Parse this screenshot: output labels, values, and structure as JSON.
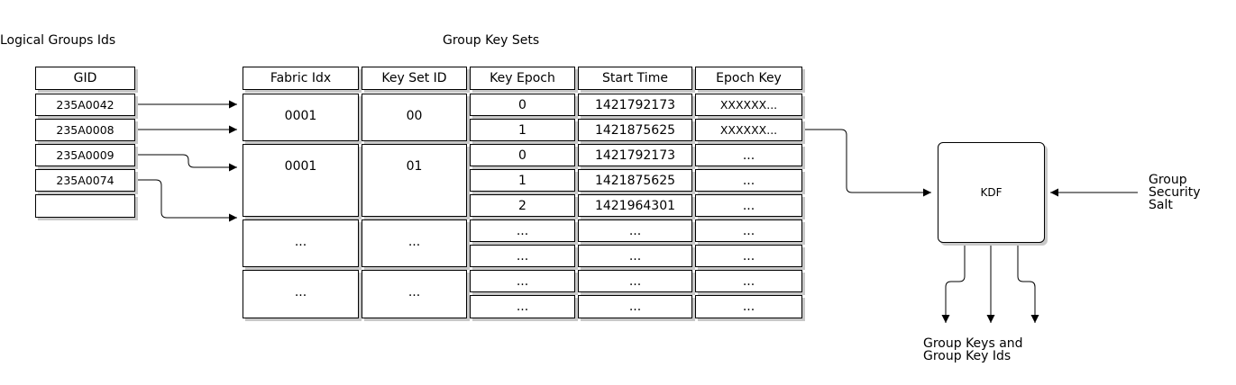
{
  "titles": {
    "logical_groups": "Logical Groups Ids",
    "key_sets": "Group Key Sets",
    "salt": [
      "Group",
      "Security",
      "Salt"
    ],
    "output": [
      "Group Keys and",
      "Group Key Ids"
    ]
  },
  "gid": {
    "header": "GID",
    "rows": [
      "235A0042",
      "235A0008",
      "235A0009",
      "235A0074",
      ""
    ]
  },
  "table": {
    "headers": [
      "Fabric Idx",
      "Key Set ID",
      "Key Epoch",
      "Start Time",
      "Epoch Key"
    ],
    "groups": [
      {
        "fabric_idx": "0001",
        "key_set_id": "00"
      },
      {
        "fabric_idx": "0001",
        "key_set_id": "01"
      },
      {
        "fabric_idx": "...",
        "key_set_id": "..."
      },
      {
        "fabric_idx": "...",
        "key_set_id": "..."
      }
    ],
    "rows": [
      [
        "0",
        "1421792173",
        "XXXXXX..."
      ],
      [
        "1",
        "1421875625",
        "XXXXXX..."
      ],
      [
        "0",
        "1421792173",
        "..."
      ],
      [
        "1",
        "1421875625",
        "..."
      ],
      [
        "2",
        "1421964301",
        "..."
      ],
      [
        "...",
        "...",
        "..."
      ],
      [
        "...",
        "...",
        "..."
      ],
      [
        "...",
        "...",
        "..."
      ],
      [
        "...",
        "...",
        "..."
      ]
    ]
  },
  "kdf": {
    "label": "KDF"
  }
}
